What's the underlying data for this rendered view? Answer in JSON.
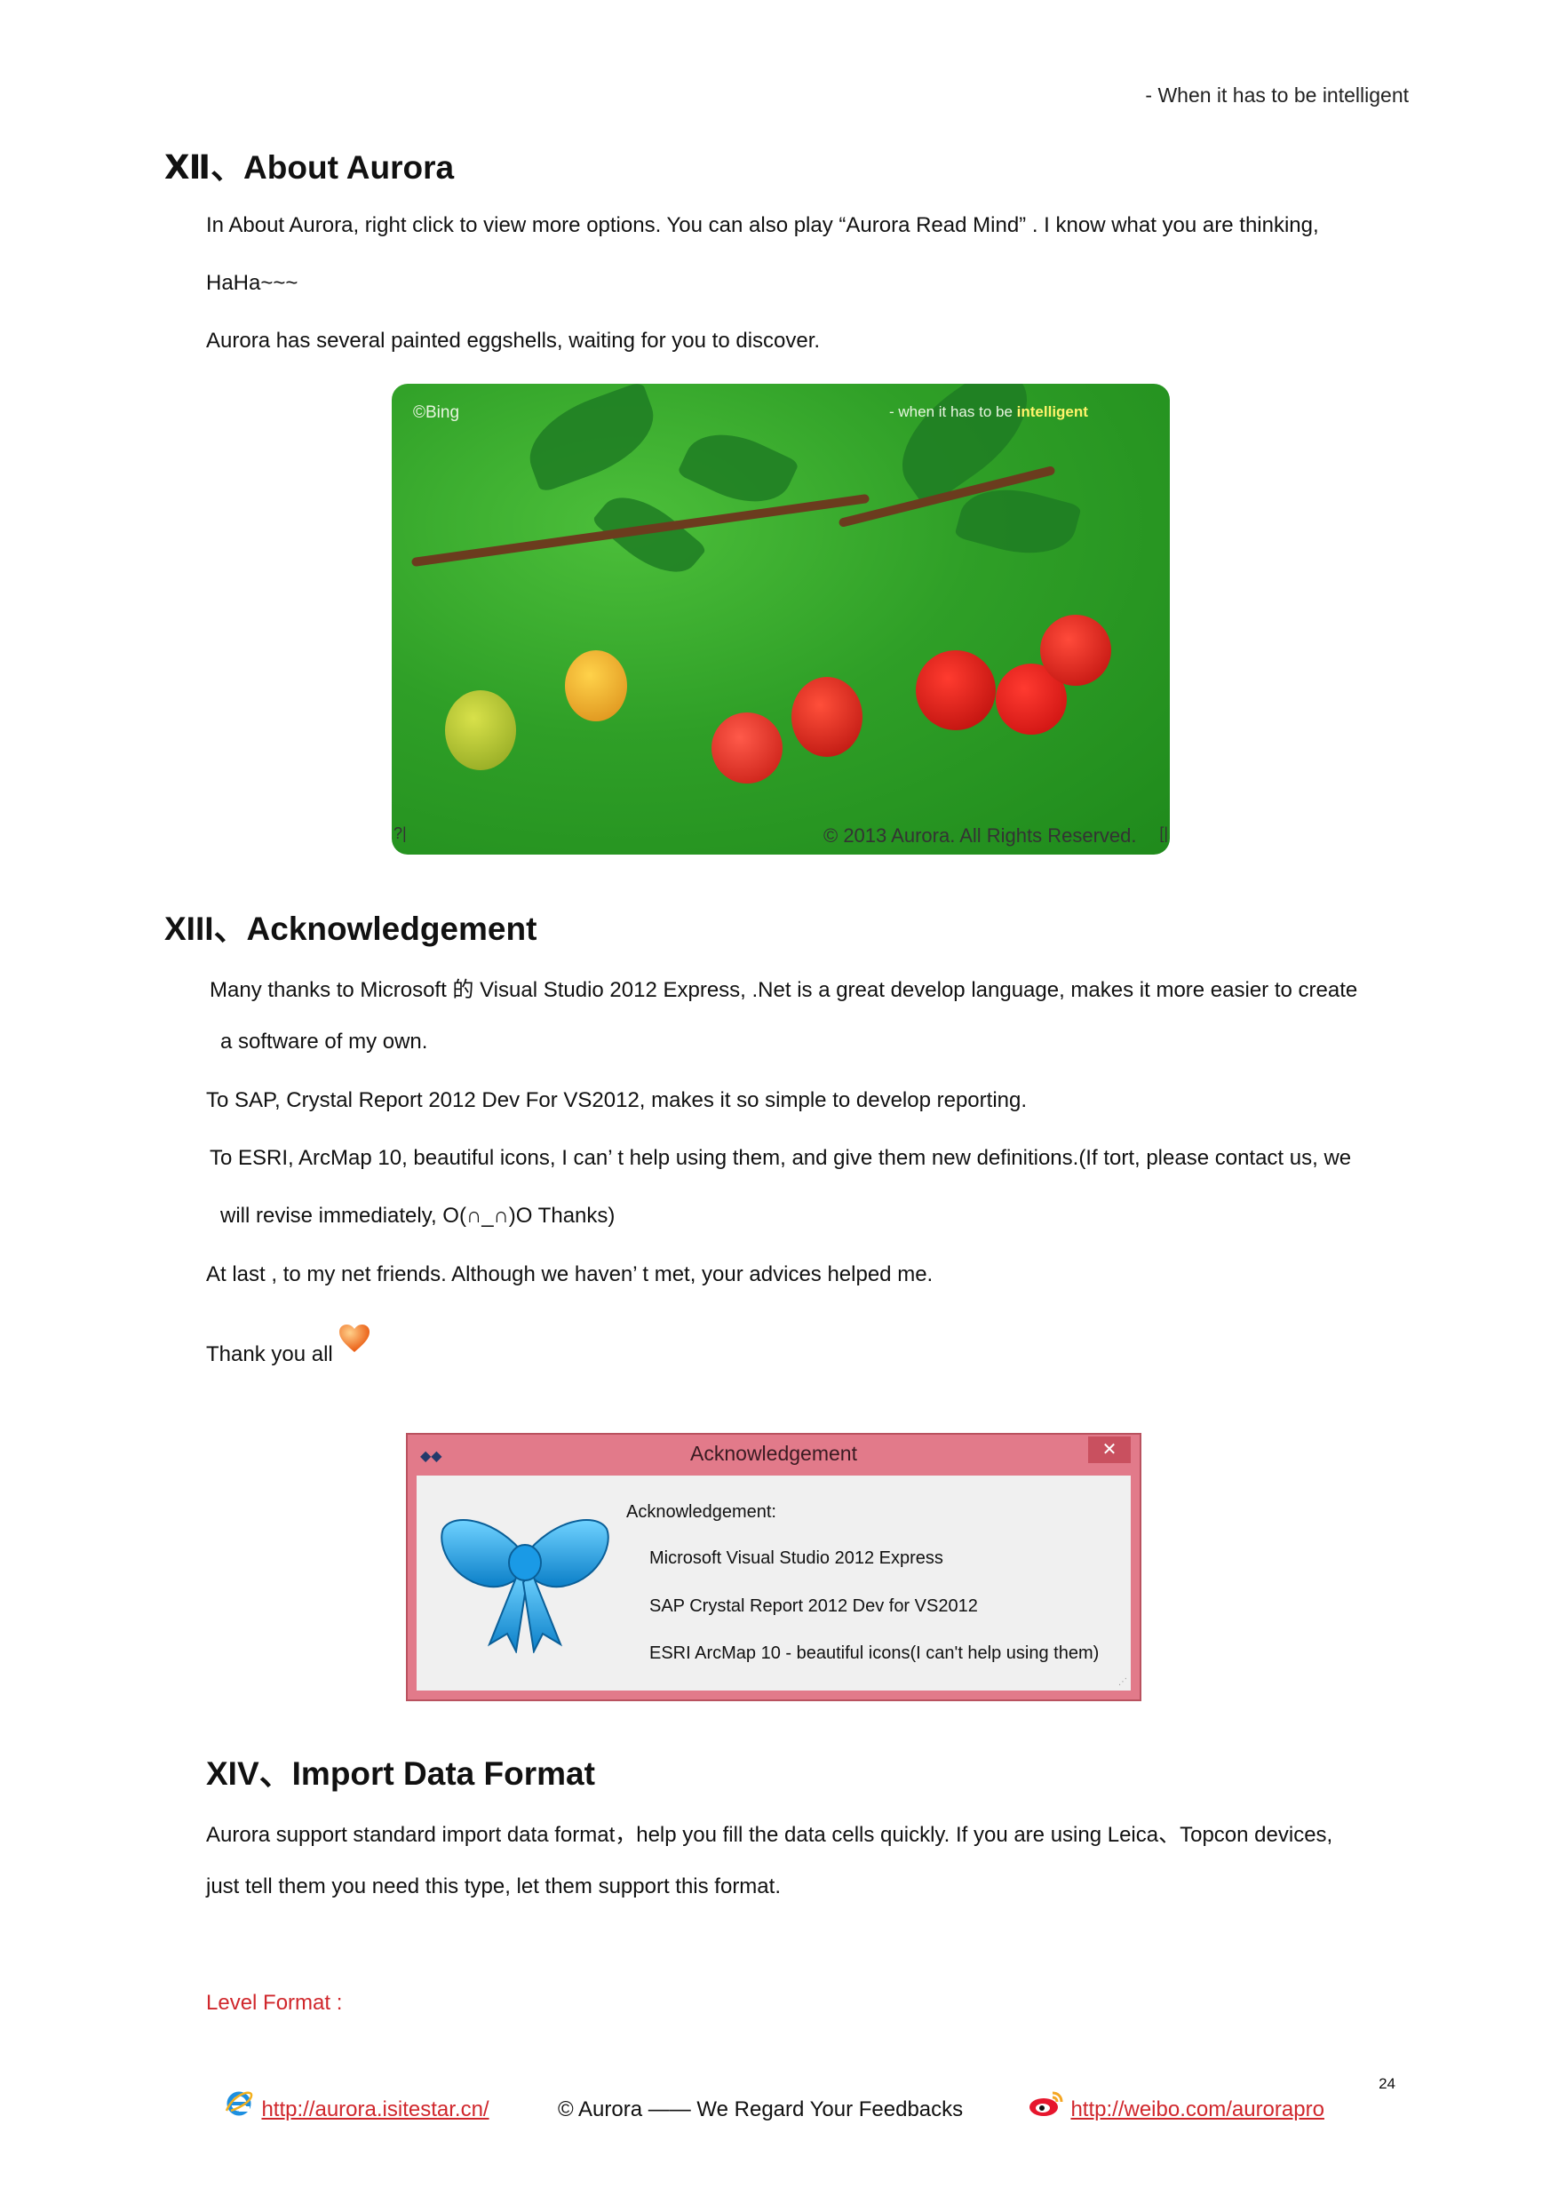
{
  "header": {
    "tagline": "- When it has to be intelligent"
  },
  "sections": {
    "about": {
      "heading": "Ⅻ、About Aurora",
      "p1": "In About Aurora, right click to view more options. You can also play  “Aurora Read Mind” . I know what you are thinking,",
      "p1b": "HaHa~~~",
      "p2": "Aurora has several painted eggshells, waiting for you to discover.",
      "image": {
        "bing": "©Bing",
        "slogan_pre": "- when it has to be",
        "slogan_word": "intelligent",
        "copyright": "© 2013 Aurora. All Rights Reserved.",
        "edge_left": "?|",
        "edge_right": "[|"
      }
    },
    "ack": {
      "heading": "XIII、Acknowledgement",
      "p1": "Many thanks to Microsoft 的 Visual Studio 2012 Express, .Net is a great develop language, makes it more easier to create",
      "p1b": "a software of my own.",
      "p2": "To SAP, Crystal Report 2012 Dev For VS2012, makes it so simple to develop reporting.",
      "p3": "To ESRI, ArcMap 10, beautiful icons, I can’ t help using them, and give them new definitions.(If tort, please contact us, we",
      "p3b": "will revise immediately, O(∩_∩)O Thanks)",
      "p4": "At last , to my net friends. Although we haven’ t met, your advices helped me.",
      "p5": "Thank you all",
      "dialog": {
        "title": "Acknowledgement",
        "close": "✕",
        "label": "Acknowledgement:",
        "items": [
          "Microsoft Visual Studio 2012 Express",
          "SAP Crystal Report 2012 Dev for VS2012",
          "ESRI ArcMap 10 - beautiful icons(I can't help using them)"
        ]
      }
    },
    "import": {
      "heading": "XIV、Import Data Format",
      "p1": "Aurora support standard import data format，help you fill the data cells quickly. If you are using Leica、Topcon devices,",
      "p2": "just tell them you need this type, let them support this format.",
      "level": "Level Format :"
    }
  },
  "page_number": "24",
  "footer": {
    "site": "http://aurora.isitestar.cn/",
    "mid": "© Aurora —— We Regard Your Feedbacks",
    "weibo": "http://weibo.com/aurorapro"
  },
  "colors": {
    "accent_red": "#d0272c",
    "dialog_pink": "#e27a8a"
  },
  "icons": [
    "heart-icon",
    "bow-icon",
    "ie-icon",
    "weibo-icon",
    "close-icon"
  ]
}
